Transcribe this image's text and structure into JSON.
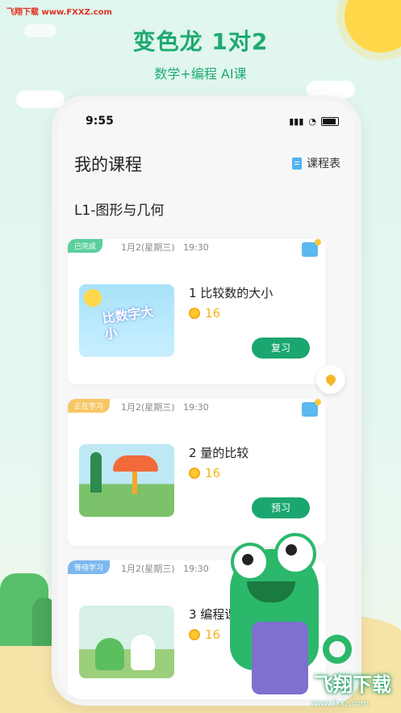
{
  "watermark": "飞翔下载 www.FXXZ.com",
  "header": {
    "title": "变色龙 1对2",
    "subtitle": "数学+编程 AI课"
  },
  "status_bar": {
    "time": "9:55"
  },
  "page": {
    "title": "我的课程",
    "schedule_label": "课程表"
  },
  "level": {
    "title": "L1-图形与几何"
  },
  "cards": [
    {
      "status": "已完成",
      "date": "1月2(星期三)",
      "time": "19:30",
      "lesson": "1  比较数的大小",
      "coins": "16",
      "action": "复习",
      "thumb_text": "比数字大小"
    },
    {
      "status": "正在学习",
      "date": "1月2(星期三)",
      "time": "19:30",
      "lesson": "2  量的比较",
      "coins": "16",
      "action": "预习"
    },
    {
      "status": "等待学习",
      "date": "1月2(星期三)",
      "time": "19:30",
      "lesson": "3  编程课",
      "coins": "16"
    }
  ],
  "footer": {
    "logo": "飞翔下载",
    "url": "www.fxxz.com"
  },
  "colors": {
    "brand_green": "#1faa72",
    "button_green": "#1aa66e",
    "coin_gold": "#f2b31e"
  }
}
